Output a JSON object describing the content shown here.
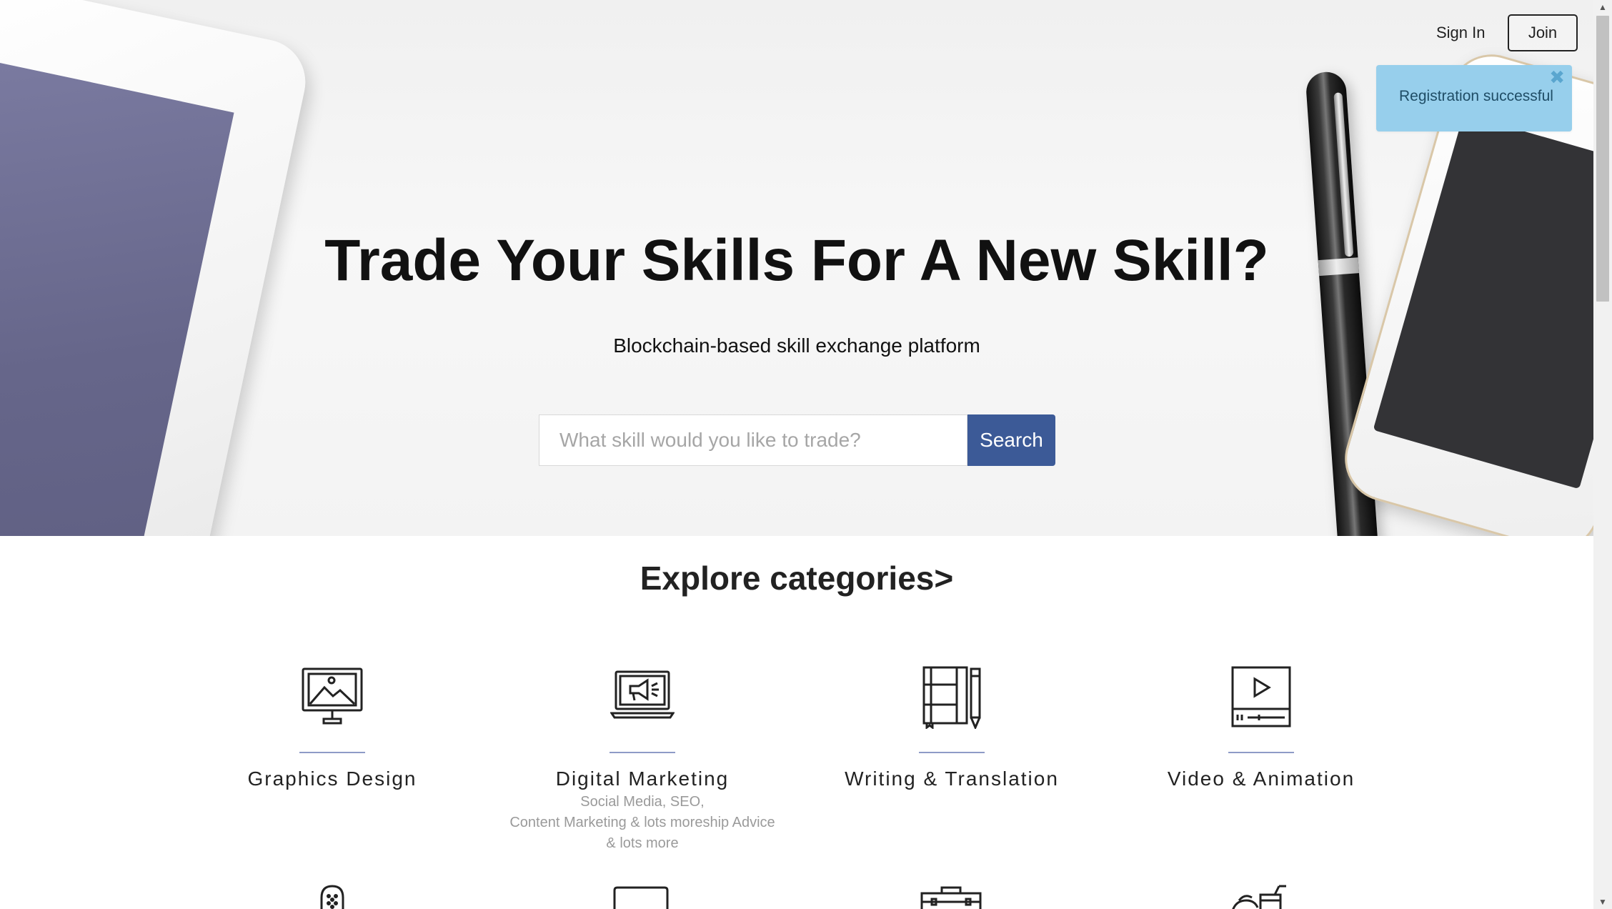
{
  "nav": {
    "signin_label": "Sign In",
    "join_label": "Join"
  },
  "toast": {
    "message": "Registration successful",
    "close_glyph": "✖",
    "color": "#97cfec"
  },
  "hero": {
    "title": "Trade Your Skills For A New Skill?",
    "subtitle": "Blockchain-based skill exchange platform",
    "search_placeholder": "What skill would you like to trade?",
    "search_value": "",
    "search_button": "Search",
    "accent_color": "#3c5a97"
  },
  "categories": {
    "heading": "Explore categories>",
    "items": [
      {
        "name": "Graphics Design",
        "icon": "monitor-image-icon",
        "desc": []
      },
      {
        "name": "Digital Marketing",
        "icon": "laptop-megaphone-icon",
        "desc": [
          "Social Media, SEO,",
          "Content Marketing & lots moreship Advice",
          "& lots more"
        ]
      },
      {
        "name": "Writing & Translation",
        "icon": "book-pencil-icon",
        "desc": []
      },
      {
        "name": "Video & Animation",
        "icon": "video-player-icon",
        "desc": []
      }
    ],
    "row2_icons": [
      "microphone-icon",
      "monitor-icon",
      "briefcase-icon",
      "food-drink-icon"
    ]
  },
  "scrollbar": {
    "up_glyph": "▲",
    "down_glyph": "▼"
  }
}
